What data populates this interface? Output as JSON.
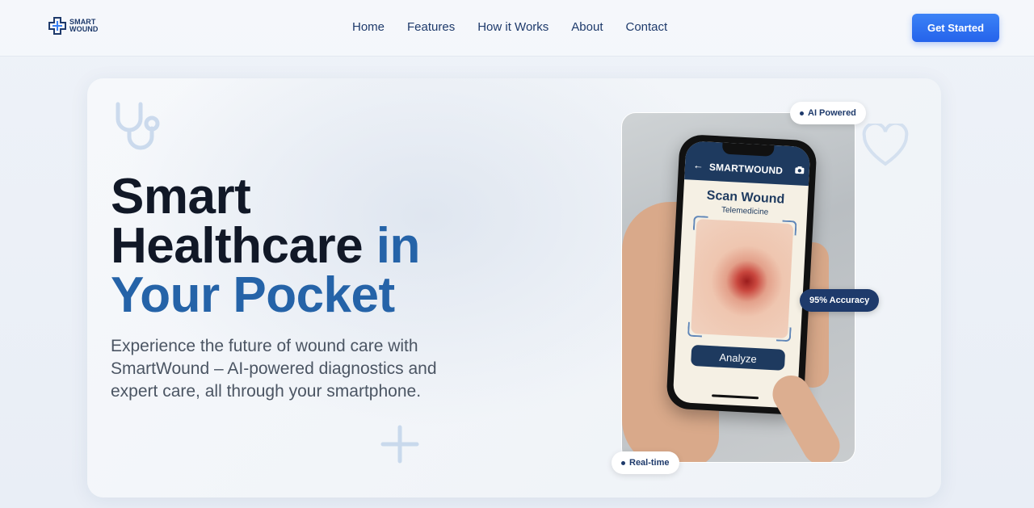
{
  "nav": {
    "logo_line1": "SMART",
    "logo_line2": "WOUND",
    "links": [
      "Home",
      "Features",
      "How it Works",
      "About",
      "Contact"
    ],
    "cta": "Get Started"
  },
  "hero": {
    "headline_part1": "Smart",
    "headline_part2": "Healthcare",
    "headline_accent1": "in",
    "headline_accent2": "Your Pocket",
    "subtext": "Experience the future of wound care with SmartWound – AI-powered diagnostics and expert care, all through your smartphone."
  },
  "phone": {
    "app_title": "SMARTWOUND",
    "scan_title": "Scan Wound",
    "scan_subtitle": "Telemedicine",
    "analyze_button": "Analyze"
  },
  "badges": {
    "ai": "AI Powered",
    "accuracy": "95% Accuracy",
    "realtime": "Real-time"
  },
  "colors": {
    "primary": "#2563eb",
    "navy": "#1e3a6b",
    "accent_text": "#2563a8"
  }
}
